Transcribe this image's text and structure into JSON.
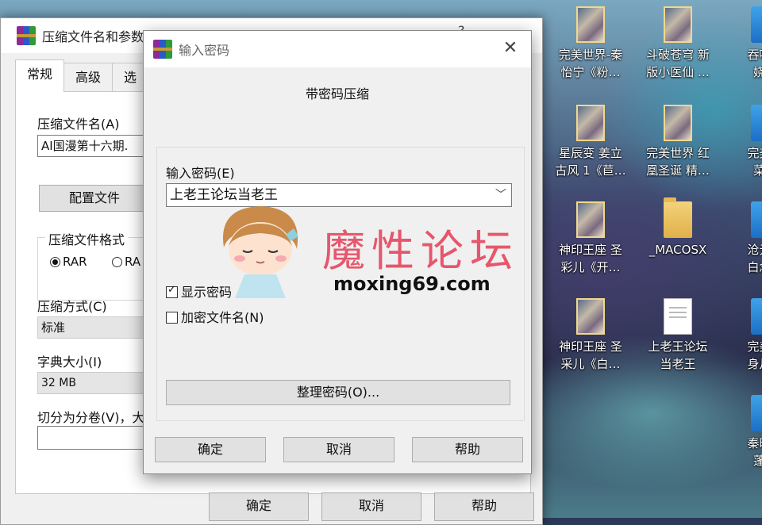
{
  "desktop": {
    "icons": [
      {
        "label": "完美世界-秦\n怡宁《粉…",
        "type": "pics"
      },
      {
        "label": "斗破苍穹 新\n版小医仙 …",
        "type": "pics"
      },
      {
        "label": "吞噬星\n娆黑",
        "type": "blue"
      },
      {
        "label": "星辰变 姜立\n古风 1《苣…",
        "type": "pics"
      },
      {
        "label": "完美世界 红\n凰圣诞 精…",
        "type": "pics"
      },
      {
        "label": "完美世\n菜《",
        "type": "blue"
      },
      {
        "label": "神印王座 圣\n彩儿《开…",
        "type": "pics"
      },
      {
        "label": "_MACOSX",
        "type": "folder"
      },
      {
        "label": "沧元图\n白念云",
        "type": "blue"
      },
      {
        "label": "神印王座 圣\n采儿《白…",
        "type": "pics"
      },
      {
        "label": "上老王论坛\n当老王",
        "type": "doc"
      },
      {
        "label": "完美世\n身月婵",
        "type": "blue"
      },
      {
        "label": "秦时明\n蓬公",
        "type": "blue"
      }
    ]
  },
  "main_window": {
    "title": "压缩文件名和参数",
    "help_char": "?",
    "tabs": [
      "常规",
      "高级",
      "选"
    ],
    "archive_name_label": "压缩文件名(A)",
    "archive_name_value": "AI国漫第十六期.",
    "profile_button": "配置文件",
    "format_group": "压缩文件格式",
    "format_rar": "RAR",
    "format_rar5": "RA",
    "method_label": "压缩方式(C)",
    "method_value": "标准",
    "dict_label": "字典大小(I)",
    "dict_value": "32 MB",
    "split_label": "切分为分卷(V)，大",
    "ok": "确定",
    "cancel": "取消",
    "help": "帮助"
  },
  "password_dialog": {
    "title": "输入密码",
    "heading": "带密码压缩",
    "password_label": "输入密码(E)",
    "password_value": "上老王论坛当老王",
    "show_password_label": "显示密码",
    "show_password_checked": true,
    "encrypt_names_label": "加密文件名(N)",
    "encrypt_names_checked": false,
    "organize_button": "整理密码(O)...",
    "ok": "确定",
    "cancel": "取消",
    "help": "帮助"
  },
  "watermark": {
    "cn": "魔性论坛",
    "url": "moxing69.com"
  }
}
